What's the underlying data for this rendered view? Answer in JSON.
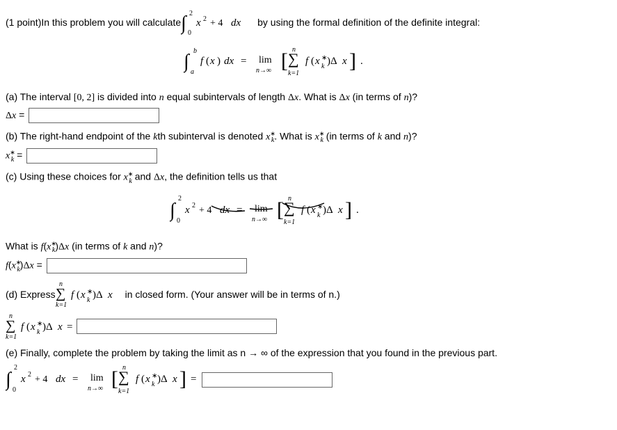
{
  "pointsLabel": "(1 point)",
  "introPrefix": " In this problem you will calculate ",
  "introSuffix": " by using the formal definition of the definite integral:",
  "parts": {
    "a": {
      "text": "(a) The interval [0, 2] is divided into n equal subintervals of length Δx. What is Δx (in terms of n)?",
      "label": "Δx ="
    },
    "b": {
      "text": "(b) The right-hand endpoint of the kth subinterval is denoted x*_k. What is x*_k (in terms of k and n)?",
      "label": "x*_k ="
    },
    "c": {
      "text": "(c) Using these choices for x*_k and Δx, the definition tells us that",
      "question": "What is f(x*_k)Δx (in terms of k and n)?",
      "label": "f(x*_k)Δx ="
    },
    "d": {
      "text": "(d) Express ",
      "textAfter": " in closed form. (Your answer will be in terms of n.)",
      "label": " ="
    },
    "e": {
      "text": "(e) Finally, complete the problem by taking the limit as n → ∞ of the expression that you found in the previous part.",
      "label": " ="
    }
  },
  "chart_data": {
    "type": "math-problem",
    "integral": "∫_0^2 (x^2 + 4) dx",
    "definition": "∫_a^b f(x) dx = lim_{n→∞} [ Σ_{k=1}^{n} f(x*_k) Δx ]",
    "interval": [
      0,
      2
    ],
    "integrand": "x^2 + 4"
  }
}
